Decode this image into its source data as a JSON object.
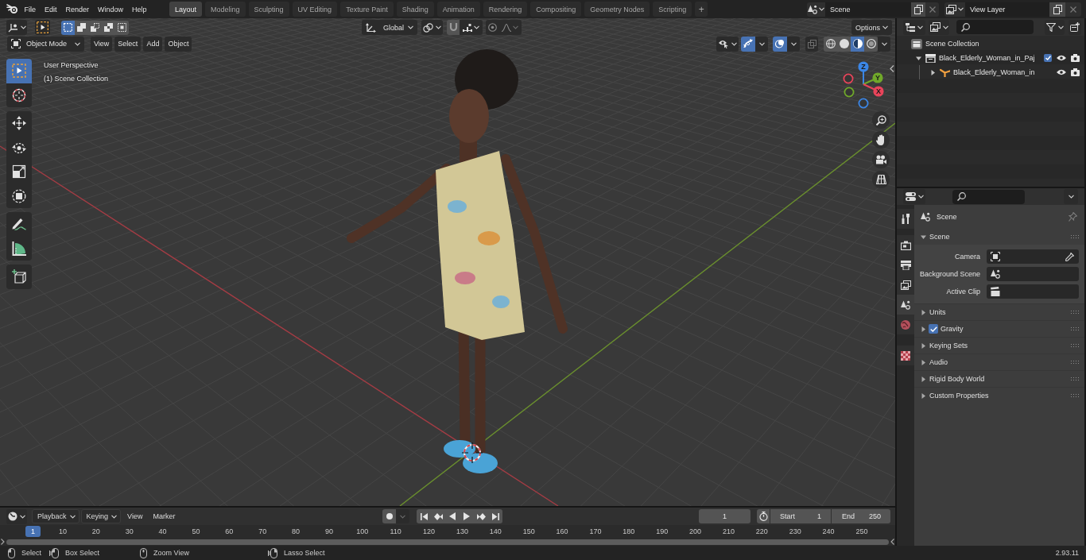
{
  "top_bar": {
    "menus": [
      "File",
      "Edit",
      "Render",
      "Window",
      "Help"
    ],
    "workspace_tabs": [
      {
        "label": "Layout",
        "selected": true
      },
      {
        "label": "Modeling",
        "selected": false
      },
      {
        "label": "Sculpting",
        "selected": false
      },
      {
        "label": "UV Editing",
        "selected": false
      },
      {
        "label": "Texture Paint",
        "selected": false
      },
      {
        "label": "Shading",
        "selected": false
      },
      {
        "label": "Animation",
        "selected": false
      },
      {
        "label": "Rendering",
        "selected": false
      },
      {
        "label": "Compositing",
        "selected": false
      },
      {
        "label": "Geometry Nodes",
        "selected": false
      },
      {
        "label": "Scripting",
        "selected": false
      }
    ],
    "add_tab": "+",
    "scene": {
      "value": "Scene"
    },
    "view_layer": {
      "value": "View Layer"
    }
  },
  "viewport": {
    "select_modes": [
      {
        "kind": "set",
        "selected": true
      },
      {
        "kind": "extend",
        "selected": false
      },
      {
        "kind": "subtract",
        "selected": false
      },
      {
        "kind": "difference",
        "selected": false
      },
      {
        "kind": "intersect",
        "selected": false
      }
    ],
    "transform_orientation": "Global",
    "options": "Options",
    "mode": "Object Mode",
    "menus": [
      "View",
      "Select",
      "Add",
      "Object"
    ],
    "shading_modes": [
      {
        "kind": "wireframe",
        "selected": false
      },
      {
        "kind": "solid",
        "selected": false
      },
      {
        "kind": "material",
        "selected": true
      },
      {
        "kind": "rendered",
        "selected": false
      }
    ],
    "overlay_lines": [
      "User Perspective",
      "(1) Scene Collection"
    ],
    "tools": [
      {
        "kind": "select_box",
        "selected": true
      },
      {
        "kind": "cursor",
        "selected": false
      },
      {
        "kind": "move",
        "selected": false
      },
      {
        "kind": "rotate",
        "selected": false
      },
      {
        "kind": "scale",
        "selected": false
      },
      {
        "kind": "transform",
        "selected": false
      },
      {
        "kind": "annotate",
        "selected": false
      },
      {
        "kind": "measure",
        "selected": false
      },
      {
        "kind": "add_cube",
        "selected": false
      }
    ],
    "gizmo_axes": [
      {
        "label": "Z",
        "color": "#3b86e6"
      },
      {
        "label": "Y",
        "color": "#70a82a"
      },
      {
        "label": "X",
        "color": "#e8445a"
      }
    ]
  },
  "timeline": {
    "menus": [
      {
        "label": "Playback",
        "kind": "dropdown"
      },
      {
        "label": "Keying",
        "kind": "dropdown"
      },
      {
        "label": "View",
        "kind": "menu"
      },
      {
        "label": "Marker",
        "kind": "menu"
      }
    ],
    "current_frame": "1",
    "start": {
      "label": "Start",
      "value": "1"
    },
    "end": {
      "label": "End",
      "value": "250"
    },
    "playhead": "1",
    "ruler_labels": [
      "10",
      "20",
      "30",
      "40",
      "50",
      "60",
      "70",
      "80",
      "90",
      "100",
      "110",
      "120",
      "130",
      "140",
      "150",
      "160",
      "170",
      "180",
      "190",
      "200",
      "210",
      "220",
      "230",
      "240",
      "250"
    ]
  },
  "outliner": {
    "tree": [
      {
        "label": "Scene Collection",
        "kind": "scene_collection",
        "children": [
          {
            "label": "Black_Elderly_Woman_in_Paj",
            "kind": "collection",
            "expanded": true,
            "checked": true,
            "children": [
              {
                "label": "Black_Elderly_Woman_in",
                "kind": "armature",
                "expanded": false
              }
            ]
          }
        ]
      }
    ]
  },
  "properties": {
    "tabs": [
      {
        "kind": "tool",
        "selected": false
      },
      {
        "kind": "render",
        "selected": false
      },
      {
        "kind": "output",
        "selected": false
      },
      {
        "kind": "view_layer",
        "selected": false
      },
      {
        "kind": "scene",
        "selected": true
      },
      {
        "kind": "world",
        "selected": false
      },
      {
        "kind": "texture",
        "selected": false
      }
    ],
    "context": "Scene",
    "panels": [
      {
        "label": "Scene",
        "expanded": true,
        "fields": [
          {
            "label": "Camera",
            "kind": "camera"
          },
          {
            "label": "Background Scene",
            "kind": "scene"
          },
          {
            "label": "Active Clip",
            "kind": "clip"
          }
        ]
      },
      {
        "label": "Units",
        "expanded": false
      },
      {
        "label": "Gravity",
        "expanded": false,
        "toggle": {
          "checked": true
        }
      },
      {
        "label": "Keying Sets",
        "expanded": false
      },
      {
        "label": "Audio",
        "expanded": false
      },
      {
        "label": "Rigid Body World",
        "expanded": false
      },
      {
        "label": "Custom Properties",
        "expanded": false
      }
    ]
  },
  "status_bar": {
    "hints": [
      {
        "kind": "left_click",
        "label": "Select"
      },
      {
        "kind": "left_drag",
        "label": "Box Select"
      },
      {
        "kind": "middle",
        "label": "Zoom View"
      },
      {
        "kind": "right_drag",
        "label": "Lasso Select"
      }
    ],
    "version": "2.93.11"
  }
}
